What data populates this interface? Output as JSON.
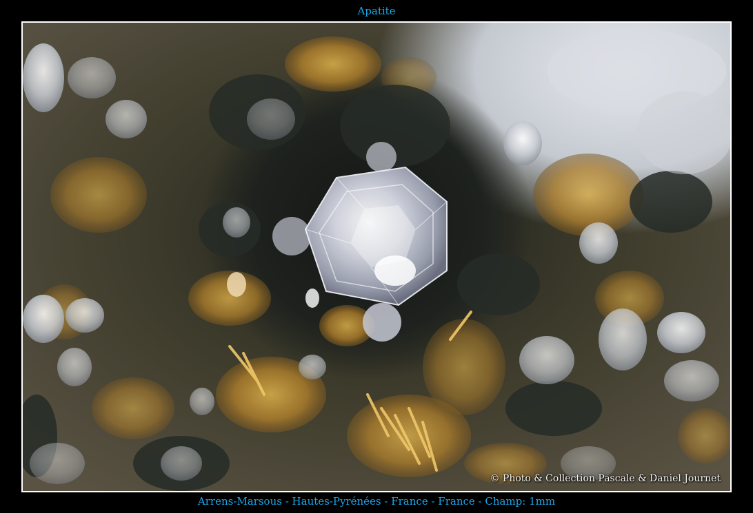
{
  "title": "Apatite",
  "caption": "Arrens-Marsous - Hautes-Pyrénées - France - France - Champ: 1mm",
  "copyright": "© Photo & Collection Pascale & Daniel Journet",
  "colors": {
    "text_accent": "#1fa6e8",
    "frame_border": "#ffffff",
    "background": "#000000"
  }
}
